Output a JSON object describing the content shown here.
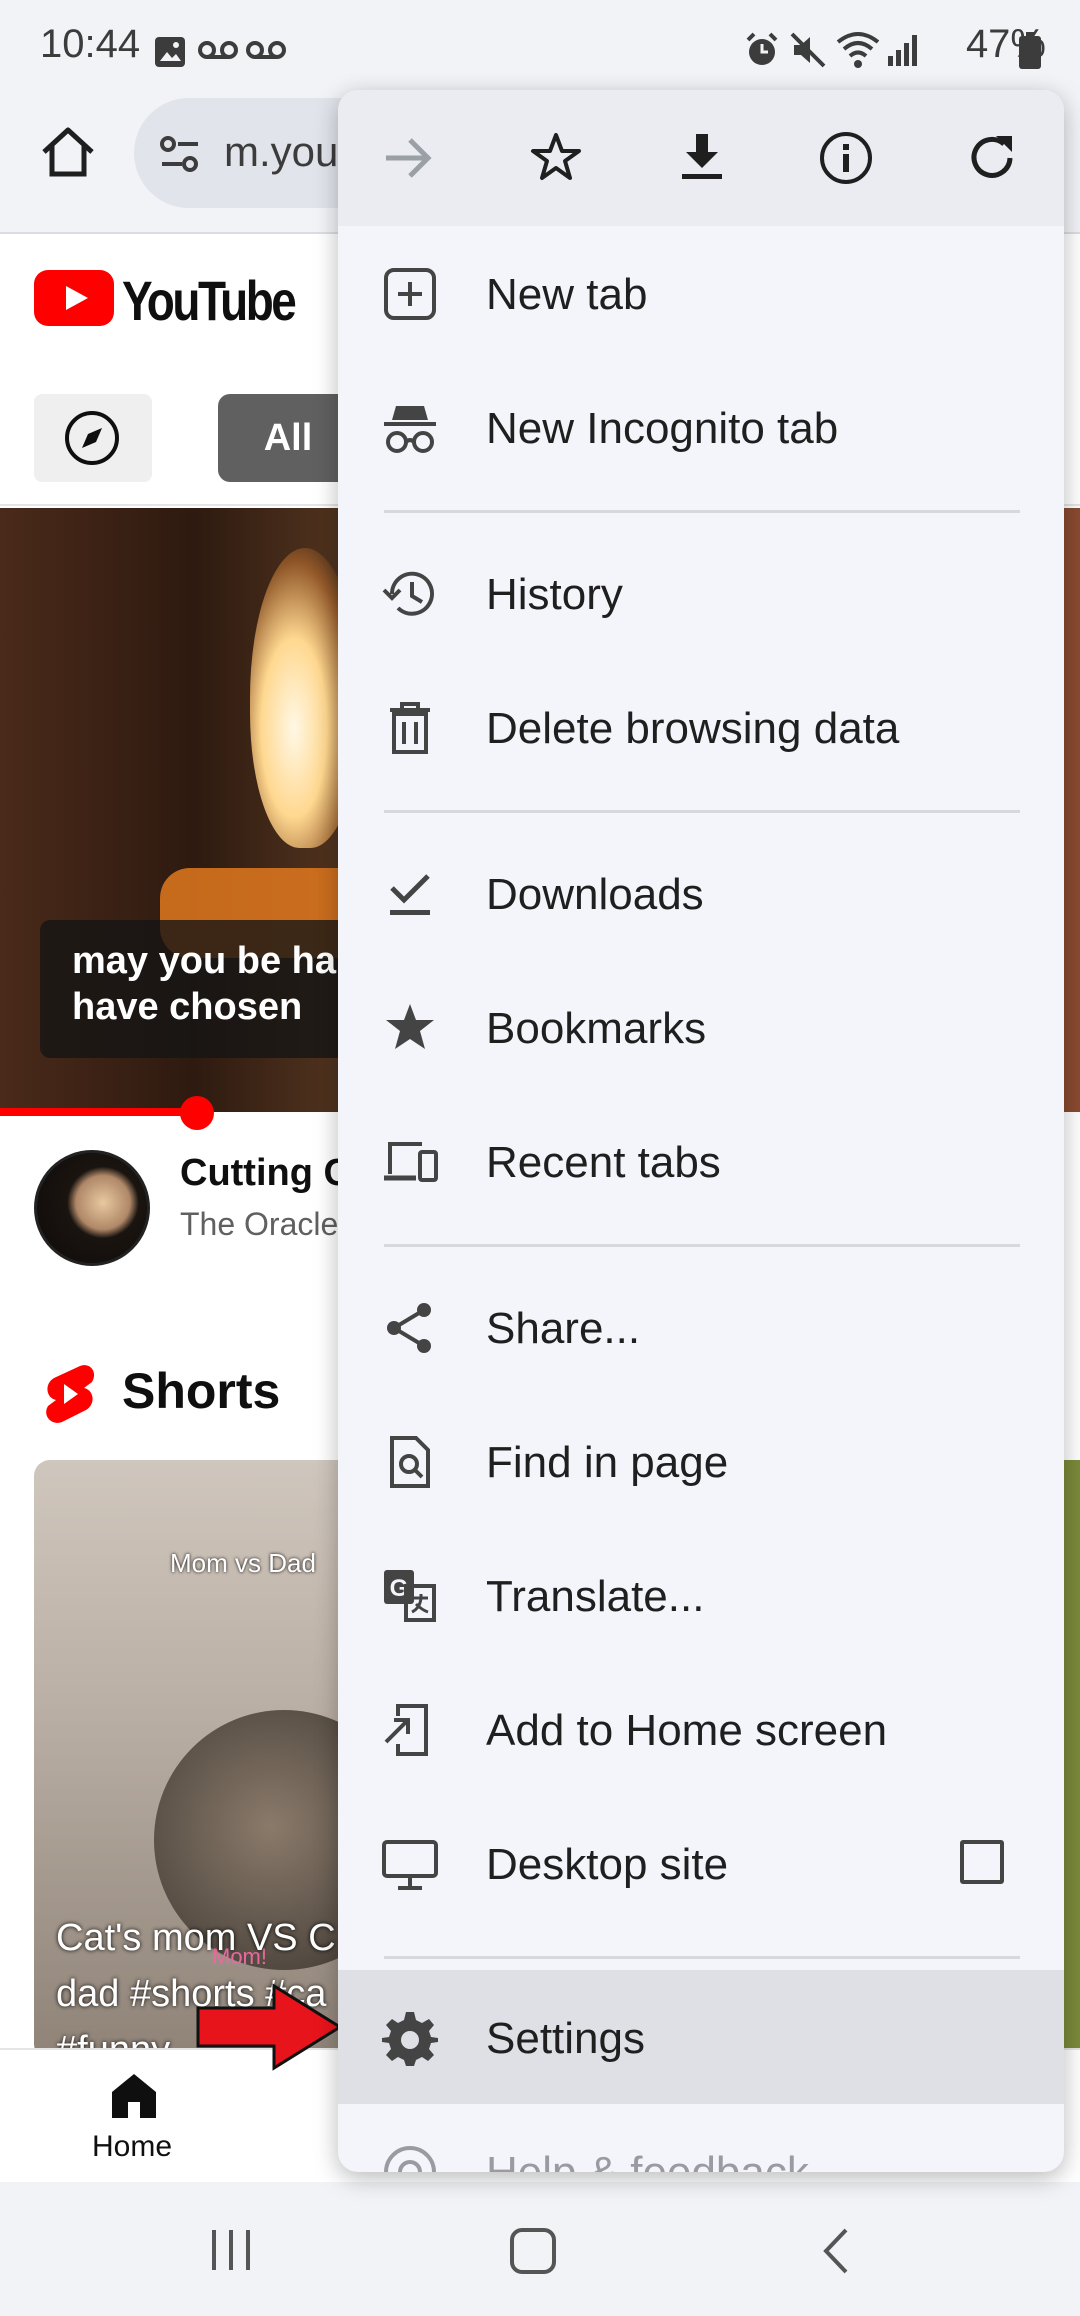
{
  "status_bar": {
    "time": "10:44",
    "battery": "47%"
  },
  "address_bar": {
    "url": "m.you"
  },
  "youtube": {
    "logo_text": "YouTube",
    "chip_all": "All",
    "video_caption": [
      "may you be hap",
      "have chosen"
    ],
    "video_title": "Cutting C",
    "video_channel": "The Oracle",
    "shorts_title": "Shorts",
    "short_overlay": "Mom vs Dad",
    "short_mom_tag": "Mom!",
    "short_caption": [
      "Cat's mom VS C",
      "dad #shorts #ca",
      "#funny"
    ],
    "nav_home": "Home"
  },
  "menu": {
    "toolbar_icons": [
      "forward-icon",
      "star-icon",
      "download-icon",
      "info-icon",
      "reload-icon"
    ],
    "items": {
      "new_tab": "New tab",
      "incognito": "New Incognito tab",
      "history": "History",
      "delete_data": "Delete browsing data",
      "downloads": "Downloads",
      "bookmarks": "Bookmarks",
      "recent_tabs": "Recent tabs",
      "share": "Share...",
      "find": "Find in page",
      "translate": "Translate...",
      "add_home": "Add to Home screen",
      "desktop_site": "Desktop site",
      "settings": "Settings",
      "help": "Help & feedback"
    },
    "desktop_site_checked": false
  },
  "colors": {
    "menu_bg": "#f4f5fb",
    "highlight": "#dfe0e5",
    "youtube_red": "#ff0000",
    "arrow_red": "#e8141c"
  }
}
